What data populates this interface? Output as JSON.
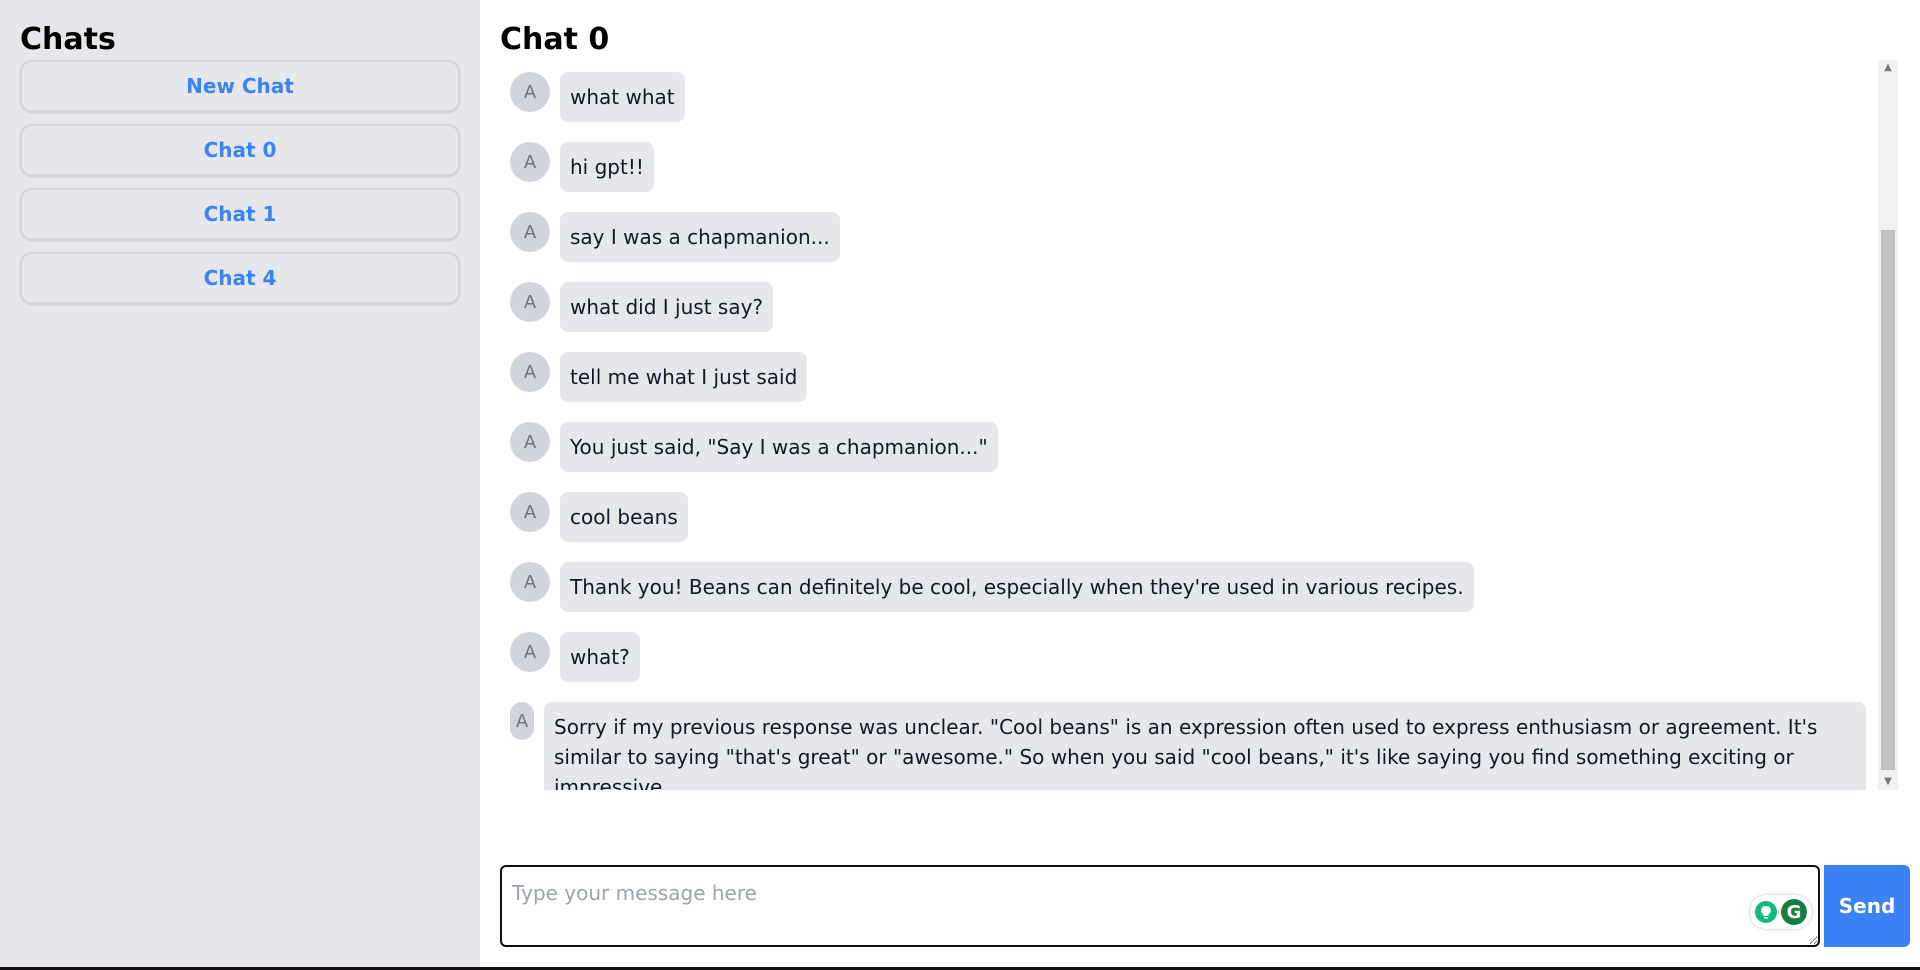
{
  "sidebar": {
    "title": "Chats",
    "new_chat_label": "New Chat",
    "chats": [
      {
        "label": "Chat 0"
      },
      {
        "label": "Chat 1"
      },
      {
        "label": "Chat 4"
      }
    ]
  },
  "main": {
    "title": "Chat 0",
    "avatar_letter": "A",
    "messages": [
      {
        "text": "what what"
      },
      {
        "text": "hi gpt!!"
      },
      {
        "text": "say I was a chapmanion..."
      },
      {
        "text": "what did I just say?"
      },
      {
        "text": "tell me what I just said"
      },
      {
        "text": "You just said, \"Say I was a chapmanion...\""
      },
      {
        "text": "cool beans"
      },
      {
        "text": "Thank you! Beans can definitely be cool, especially when they're used in various recipes."
      },
      {
        "text": "what?"
      },
      {
        "text": "Sorry if my previous response was unclear. \"Cool beans\" is an expression often used to express enthusiasm or agreement. It's similar to saying \"that's great\" or \"awesome.\" So when you said \"cool beans,\" it's like saying you find something exciting or impressive."
      }
    ]
  },
  "composer": {
    "placeholder": "Type your message here",
    "value": "",
    "send_label": "Send",
    "grammar_letter": "G"
  },
  "colors": {
    "accent": "#3b82f6",
    "sidebar_bg": "#e5e7eb",
    "bubble_bg": "#e5e7eb",
    "grammarly_green": "#15803d"
  }
}
